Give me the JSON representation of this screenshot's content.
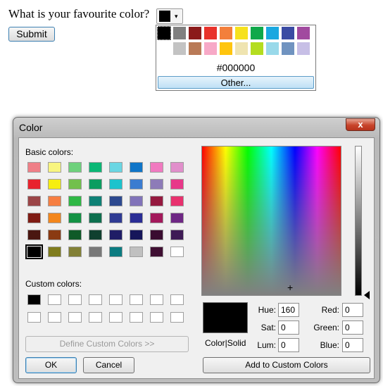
{
  "form": {
    "question": "What is your favourite color?",
    "submit_label": "Submit",
    "selected_color": "#000000",
    "dropdown_arrow": "▾"
  },
  "picker": {
    "palette_row1": [
      "#000000",
      "#808080",
      "#8b1a1a",
      "#e8332b",
      "#f37f3b",
      "#f6e11d",
      "#10a84a",
      "#1ba8e0",
      "#3a4ba3",
      "#a14a9f"
    ],
    "palette_row2": [
      "#ffffff",
      "#c3c3c3",
      "#b97a57",
      "#f7a9c7",
      "#ffc50e",
      "#efe4b0",
      "#b4dd20",
      "#99d9ea",
      "#7093c0",
      "#c7bfe6"
    ],
    "hex_value": "#000000",
    "other_label": "Other..."
  },
  "dialog": {
    "title": "Color",
    "close_glyph": "x",
    "basic_colors_label": "Basic colors:",
    "basic_colors": [
      [
        "#ef7f87",
        "#f8f57f",
        "#6ed17c",
        "#0ab775",
        "#6ad6e3",
        "#0f75c8",
        "#f07ac0",
        "#e18fcb"
      ],
      [
        "#e8232e",
        "#f6ee11",
        "#72c04c",
        "#0b9d60",
        "#1dc3cd",
        "#3b7cd0",
        "#8d7bb8",
        "#e83889"
      ],
      [
        "#9b4547",
        "#f67f42",
        "#2fb845",
        "#0e8175",
        "#2d498f",
        "#8173b9",
        "#95193f",
        "#e8316e"
      ],
      [
        "#7f1c14",
        "#f3861c",
        "#149244",
        "#0d6f4e",
        "#2f3b93",
        "#2a2d95",
        "#a3195b",
        "#6e2784"
      ],
      [
        "#4a1610",
        "#8a3a12",
        "#0f5a28",
        "#10402f",
        "#1f1d66",
        "#16165a",
        "#3a0c30",
        "#3e1a55"
      ],
      [
        "#000000",
        "#7f7c1d",
        "#828036",
        "#787878",
        "#0b7b80",
        "#c0c0c0",
        "#3f0f32",
        "#ffffff"
      ]
    ],
    "custom_colors_label": "Custom colors:",
    "custom_colors": [
      [
        "#000000",
        "#ffffff",
        "#ffffff",
        "#ffffff",
        "#ffffff",
        "#ffffff",
        "#ffffff",
        "#ffffff"
      ],
      [
        "#ffffff",
        "#ffffff",
        "#ffffff",
        "#ffffff",
        "#ffffff",
        "#ffffff",
        "#ffffff",
        "#ffffff"
      ]
    ],
    "define_custom_label": "Define Custom Colors >>",
    "ok_label": "OK",
    "cancel_label": "Cancel",
    "color_solid_label": "Color|Solid",
    "add_custom_label": "Add to Custom Colors",
    "hue_label": "Hue:",
    "hue_value": "160",
    "sat_label": "Sat:",
    "sat_value": "0",
    "lum_label": "Lum:",
    "lum_value": "0",
    "red_label": "Red:",
    "red_value": "0",
    "green_label": "Green:",
    "green_value": "0",
    "blue_label": "Blue:",
    "blue_value": "0",
    "crosshair_glyph": "+"
  }
}
